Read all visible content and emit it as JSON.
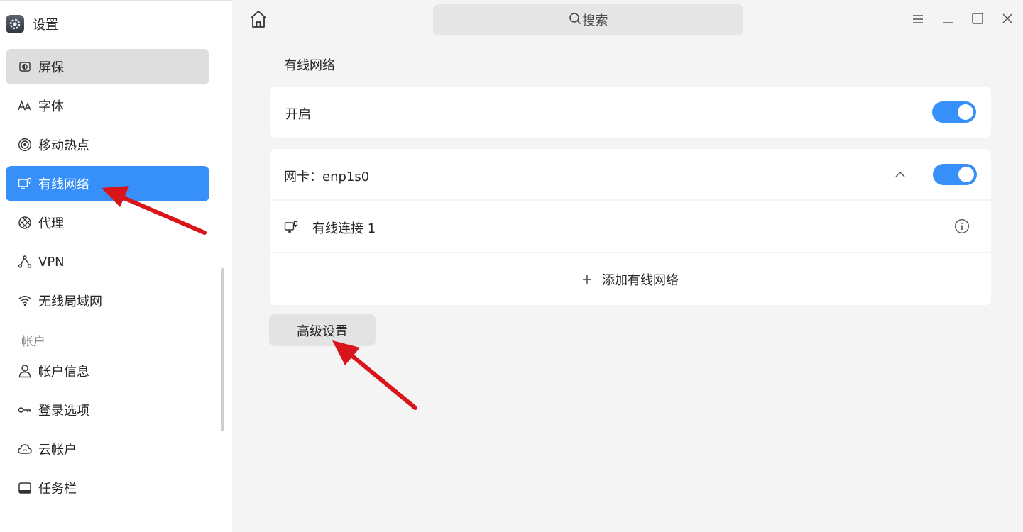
{
  "app": {
    "title": "设置"
  },
  "sidebar": {
    "items": [
      {
        "label": "屏保",
        "icon": "screensaver-icon",
        "state": "hover"
      },
      {
        "label": "字体",
        "icon": "font-icon",
        "state": ""
      },
      {
        "label": "移动热点",
        "icon": "hotspot-icon",
        "state": ""
      },
      {
        "label": "有线网络",
        "icon": "wired-network-icon",
        "state": "active"
      },
      {
        "label": "代理",
        "icon": "proxy-icon",
        "state": ""
      },
      {
        "label": "VPN",
        "icon": "vpn-icon",
        "state": ""
      },
      {
        "label": "无线局域网",
        "icon": "wifi-icon",
        "state": ""
      }
    ],
    "account_section": "帐户",
    "account_items": [
      {
        "label": "帐户信息",
        "icon": "user-icon"
      },
      {
        "label": "登录选项",
        "icon": "key-icon"
      },
      {
        "label": "云帐户",
        "icon": "cloud-icon"
      },
      {
        "label": "任务栏",
        "icon": "taskbar-icon"
      }
    ]
  },
  "titlebar": {
    "search_placeholder": "搜索"
  },
  "main": {
    "section_title": "有线网络",
    "enable_label": "开启",
    "enable_on": true,
    "nic_label": "网卡：enp1s0",
    "nic_on": true,
    "connection_label": "有线连接 1",
    "add_label": "添加有线网络",
    "advanced_label": "高级设置"
  },
  "colors": {
    "accent": "#3790fa",
    "annotation": "#d9141b"
  }
}
